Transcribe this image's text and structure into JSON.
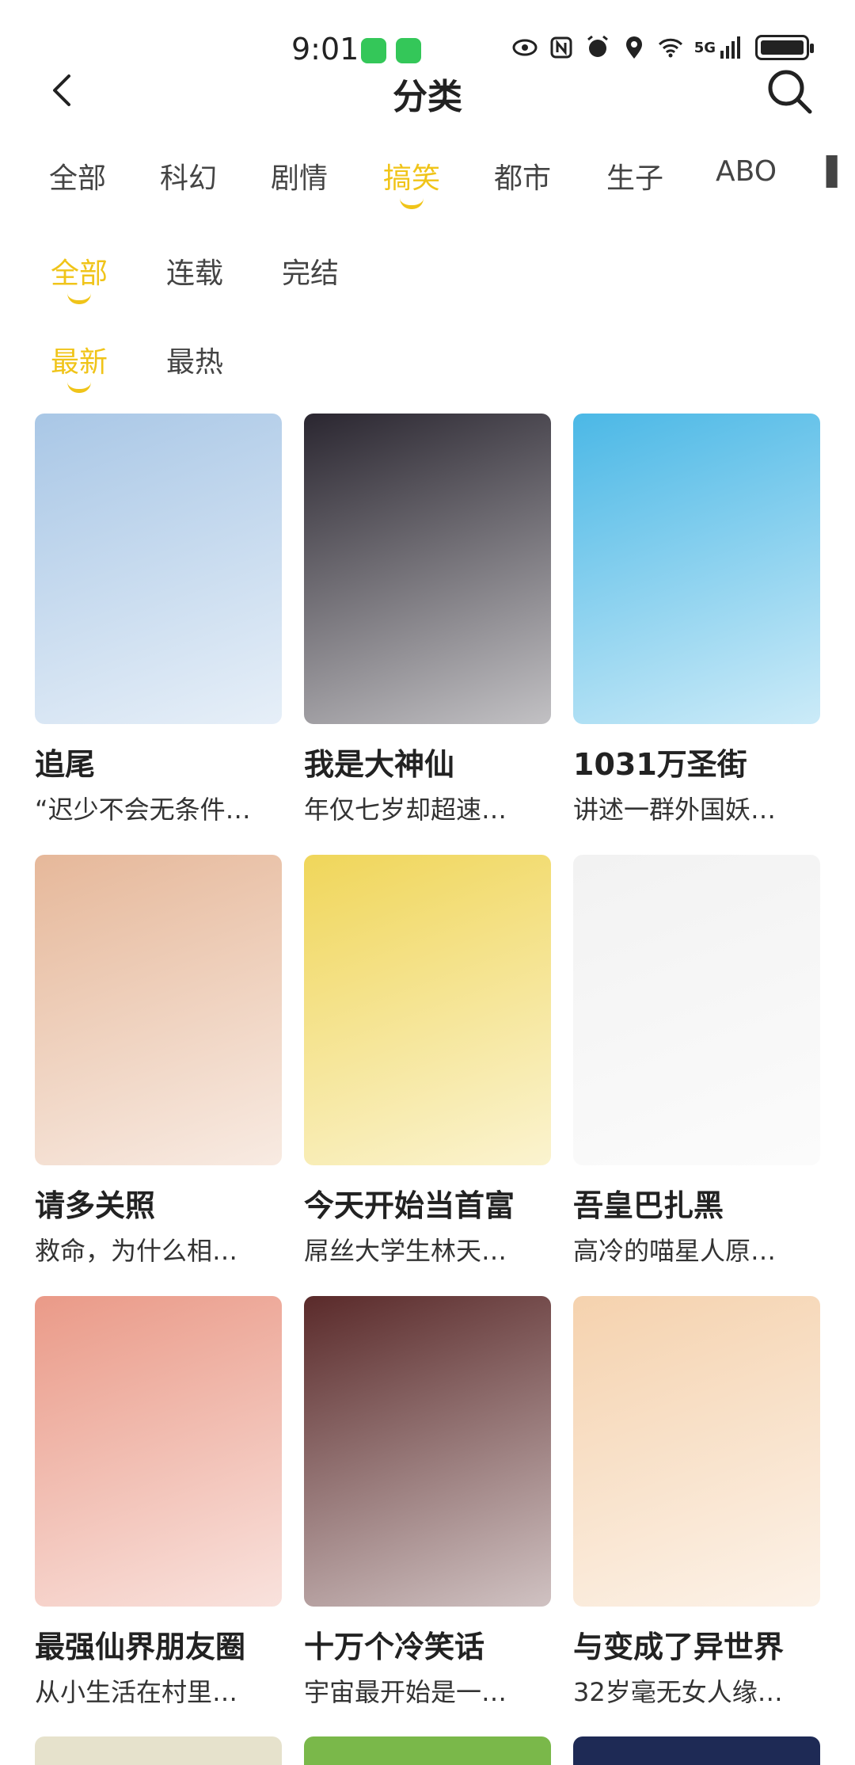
{
  "status": {
    "time": "9:01",
    "network": "5G"
  },
  "header": {
    "title": "分类"
  },
  "categories": {
    "items": [
      "全部",
      "科幻",
      "剧情",
      "搞笑",
      "都市",
      "生子",
      "ABO"
    ],
    "active_index": 3
  },
  "status_filter": {
    "items": [
      "全部",
      "连载",
      "完结"
    ],
    "active_index": 0
  },
  "sort_filter": {
    "items": [
      "最新",
      "最热"
    ],
    "active_index": 0
  },
  "comics": [
    {
      "title": "追尾",
      "desc": "“迟少不会无条件…",
      "cover_color": "#a9c7e6"
    },
    {
      "title": "我是大神仙",
      "desc": " 年仅七岁却超速…",
      "cover_color": "#2a2630"
    },
    {
      "title": "1031万圣街",
      "desc": " 讲述一群外国妖…",
      "cover_color": "#4bb8e6"
    },
    {
      "title": "请多关照",
      "desc": " 救命，为什么相…",
      "cover_color": "#e6b89a"
    },
    {
      "title": "今天开始当首富",
      "desc": " 屌丝大学生林天…",
      "cover_color": "#f0d65a"
    },
    {
      "title": "吾皇巴扎黑",
      "desc": " 高冷的喵星人原…",
      "cover_color": "#f2f2f2"
    },
    {
      "title": "最强仙界朋友圈",
      "desc": " 从小生活在村里…",
      "cover_color": "#ea9a88"
    },
    {
      "title": "十万个冷笑话",
      "desc": " 宇宙最开始是一…",
      "cover_color": "#5a2a2a"
    },
    {
      "title": " 与变成了异世界",
      "desc": " 32岁毫无女人缘…",
      "cover_color": "#f5d2ae"
    }
  ],
  "partial_covers": [
    "#e6e2cc",
    "#7ab84a",
    "#1e2a55"
  ],
  "colors": {
    "accent": "#f0c419",
    "text": "#222222"
  }
}
